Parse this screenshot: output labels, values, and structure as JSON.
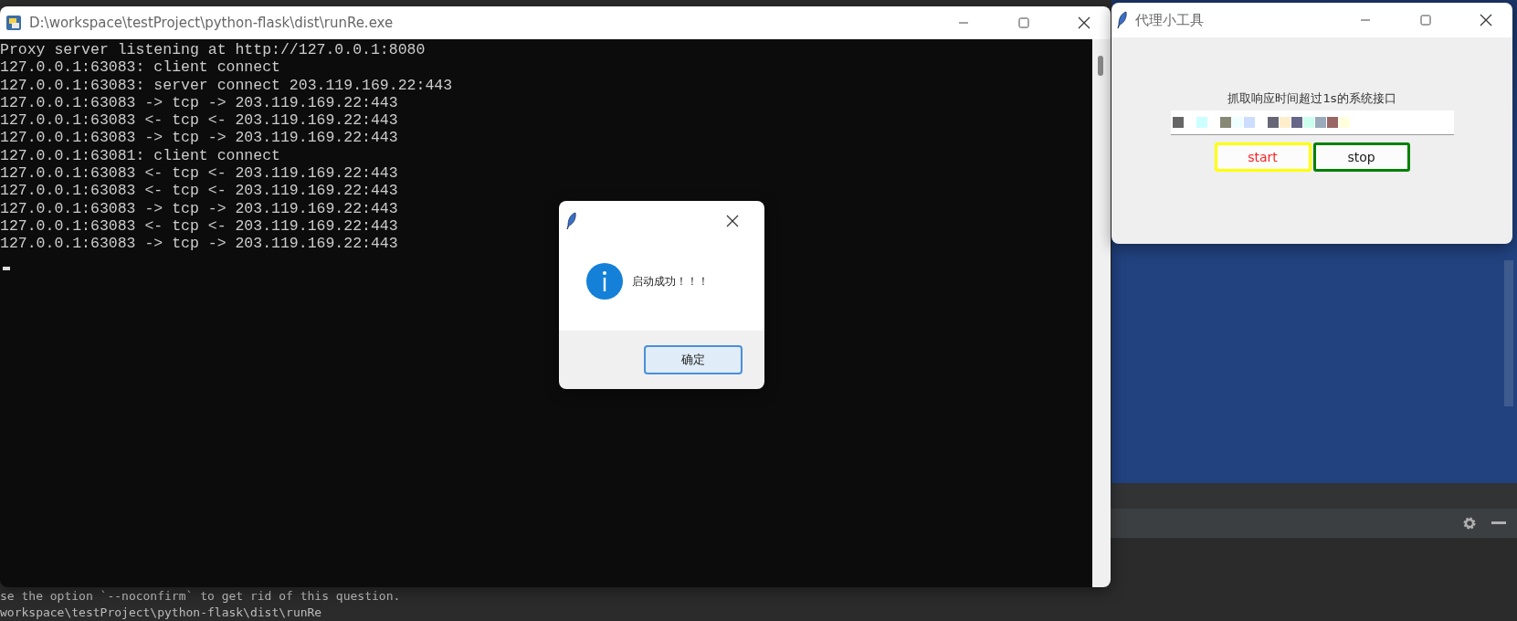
{
  "console_window": {
    "title": "D:\\workspace\\testProject\\python-flask\\dist\\runRe.exe",
    "lines": [
      "Proxy server listening at http://127.0.0.1:8080",
      "127.0.0.1:63083: client connect",
      "127.0.0.1:63083: server connect 203.119.169.22:443",
      "127.0.0.1:63083 -> tcp -> 203.119.169.22:443",
      "127.0.0.1:63083 <- tcp <- 203.119.169.22:443",
      "127.0.0.1:63083 -> tcp -> 203.119.169.22:443",
      "127.0.0.1:63081: client connect",
      "127.0.0.1:63083 <- tcp <- 203.119.169.22:443",
      "127.0.0.1:63083 <- tcp <- 203.119.169.22:443",
      "127.0.0.1:63083 -> tcp -> 203.119.169.22:443",
      "127.0.0.1:63083 <- tcp <- 203.119.169.22:443",
      "127.0.0.1:63083 -> tcp -> 203.119.169.22:443"
    ]
  },
  "tool_window": {
    "title": "代理小工具",
    "label": "抓取响应时间超过1s的系统接口",
    "buttons": [
      {
        "kind": "start",
        "label": "start",
        "color": "#ffff00"
      },
      {
        "kind": "stop",
        "label": "stop",
        "color": "#008000"
      }
    ]
  },
  "dialog": {
    "message": "启动成功！！！",
    "buttons": [
      "确定"
    ]
  },
  "ide": {
    "terminal_lines": [
      "se the option `--noconfirm` to get rid of this question.",
      "workspace\\testProject\\python-flask\\dist\\runRe"
    ]
  }
}
